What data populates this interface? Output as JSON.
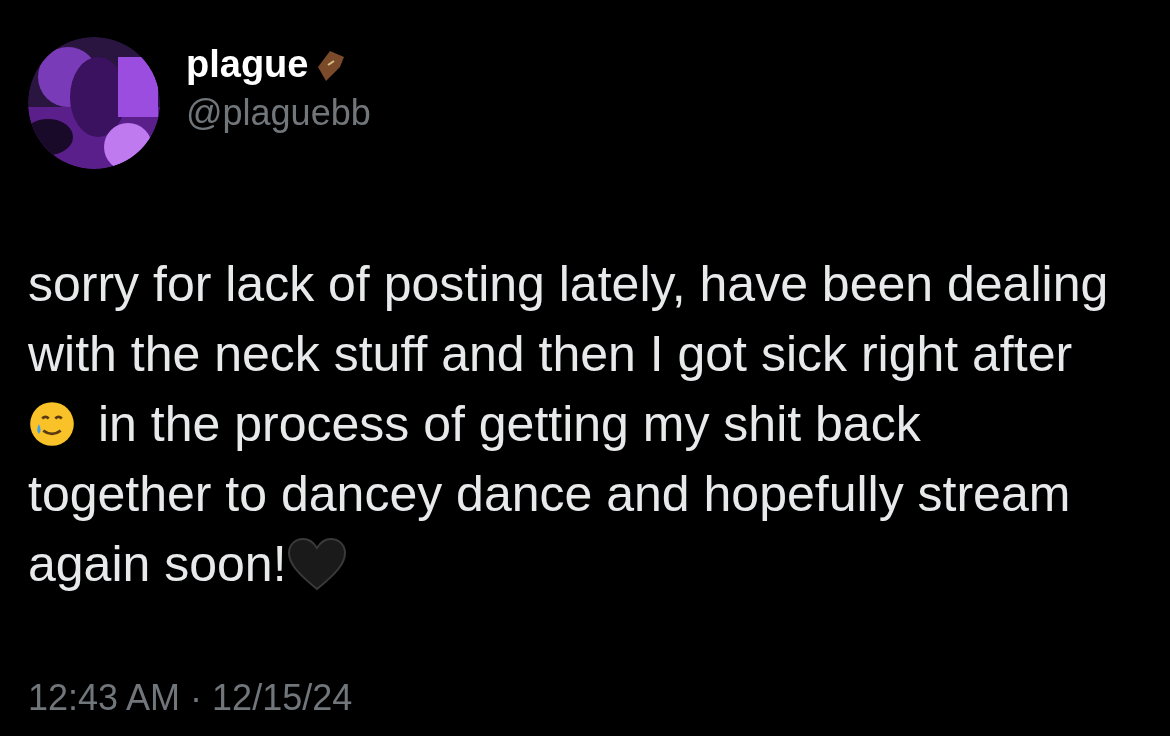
{
  "author": {
    "name": "plague",
    "handle": "@plaguebb"
  },
  "body_lines": [
    "sorry for lack of posting lately, have been dealing",
    "with the neck stuff and then I got sick right after",
    "in the process of getting my shit back",
    "together to dancey dance and hopefully stream",
    "again soon!"
  ],
  "timestamp": "12:43 AM · 12/15/24"
}
